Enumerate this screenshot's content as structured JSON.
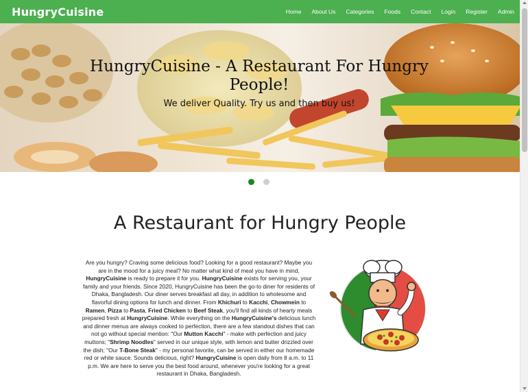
{
  "navbar": {
    "brand": "HungryCuisine",
    "links": [
      "Home",
      "About Us",
      "Categories",
      "Foods",
      "Contact",
      "Login",
      "Register",
      "Admin"
    ]
  },
  "hero": {
    "title": "HungryCuisine - A Restaurant For Hungry People!",
    "subtitle": "We deliver Quality. Try us and then buy us!"
  },
  "carousel": {
    "active_color": "#1a8a1a",
    "inactive_color": "#d0d0d0"
  },
  "about": {
    "heading": "A Restaurant for Hungry People",
    "paragraph": [
      {
        "t": "Are you hungry? Craving some delicious food? Looking for a good restaurant? Maybe you are in the mood for a juicy meal? No matter what kind of meal you have in mind, ",
        "b": false
      },
      {
        "t": "HungryCuisine",
        "b": true
      },
      {
        "t": " is ready to prepare it for you. ",
        "b": false
      },
      {
        "t": "HungryCuisine",
        "b": true
      },
      {
        "t": " exists for serving you, your family and your friends. Since 2020, HungryCuisine has been the go-to diner for residents of Dhaka, Bangladesh. Our diner serves breakfast all day, in addition to wholesome and flavorful dining options for lunch and dinner. From ",
        "b": false
      },
      {
        "t": "Khichuri",
        "b": true
      },
      {
        "t": " to ",
        "b": false
      },
      {
        "t": "Kacchi",
        "b": true
      },
      {
        "t": ", ",
        "b": false
      },
      {
        "t": "Chowmein",
        "b": true
      },
      {
        "t": " to ",
        "b": false
      },
      {
        "t": "Ramen",
        "b": true
      },
      {
        "t": ", ",
        "b": false
      },
      {
        "t": "Pizza",
        "b": true
      },
      {
        "t": " to ",
        "b": false
      },
      {
        "t": "Pasta",
        "b": true
      },
      {
        "t": ", ",
        "b": false
      },
      {
        "t": "Fried Chicken",
        "b": true
      },
      {
        "t": " to ",
        "b": false
      },
      {
        "t": "Beef Steak",
        "b": true
      },
      {
        "t": ", you'll find all kinds of hearty meals prepared fresh at ",
        "b": false
      },
      {
        "t": "HungryCuisine",
        "b": true
      },
      {
        "t": ". While everything on the ",
        "b": false
      },
      {
        "t": "HungryCuisine's",
        "b": true
      },
      {
        "t": " delicious lunch and dinner menus are always cooked to perfection, there are a few standout dishes that can not go without special mention: \"Our ",
        "b": false
      },
      {
        "t": "Mutton Kacchi",
        "b": true
      },
      {
        "t": "\" - make with perfection and juicy muttons; \"",
        "b": false
      },
      {
        "t": "Shrimp Noodles",
        "b": true
      },
      {
        "t": "\" served in our unique style, with lemon and butter drizzled over the dish; \"Our ",
        "b": false
      },
      {
        "t": "T-Bone Steak",
        "b": true
      },
      {
        "t": "\" - my personal favorite, can be served in either our homemade red or white sauce. Sounds delicious, right? ",
        "b": false
      },
      {
        "t": "HungryCuisine",
        "b": true
      },
      {
        "t": " is open daily from 8 a.m. to 11 p.m. We are here to serve you the best food around, whenever you're looking for a great restaurant in Dhaka, Bangladesh.",
        "b": false
      }
    ],
    "image_icon": "chef-mascot-icon"
  }
}
